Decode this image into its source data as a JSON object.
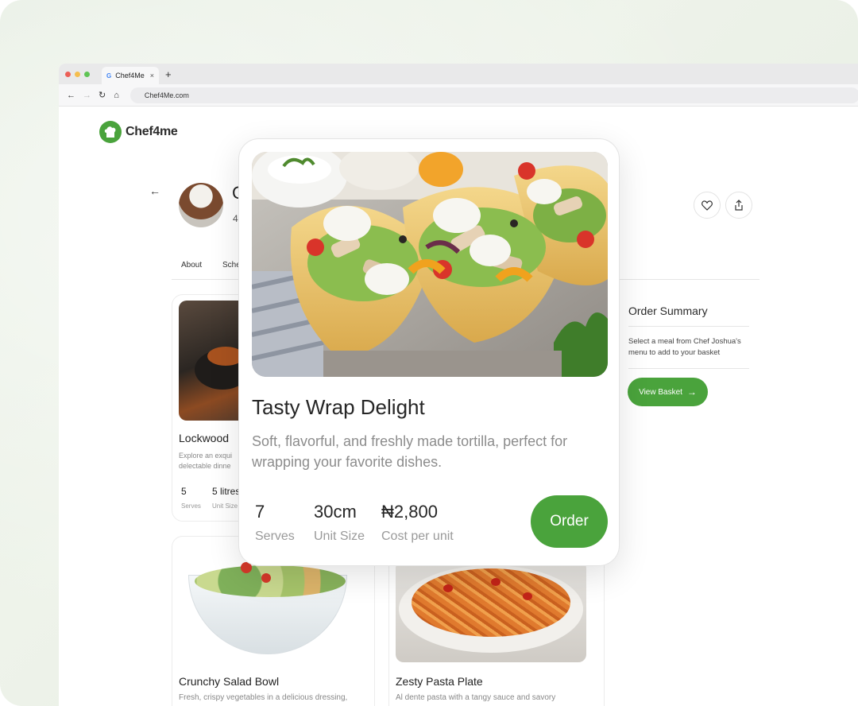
{
  "browser": {
    "tab_title": "Chef4Me",
    "tab_google_glyph": "G",
    "tab_close": "×",
    "new_tab": "+",
    "url": "Chef4Me.com",
    "traffic_lights": [
      "#ec5f57",
      "#f5be4f",
      "#5fc454"
    ]
  },
  "brand": {
    "logo_text": "Chef4me",
    "accent": "#4aa33c"
  },
  "profile": {
    "name_visible": "C",
    "meta_visible": "4"
  },
  "profile_tabs": [
    "About",
    "Sche"
  ],
  "menu_cards": [
    {
      "title": "Lockwood",
      "desc": "Explore an exqui\ndelectable dinne",
      "stats": [
        {
          "value": "5",
          "label": "Serves"
        },
        {
          "value": "5 litres",
          "label": "Unit Size"
        }
      ]
    },
    {
      "title": "Crunchy Salad Bowl",
      "desc": "Fresh, crispy vegetables in a delicious dressing,"
    },
    {
      "title": "Zesty Pasta Plate",
      "desc": "Al dente pasta with a tangy sauce and savory"
    }
  ],
  "order_summary": {
    "title": "Order Summary",
    "text": "Select a meal from Chef Joshua's menu to add to your basket",
    "button_label": "View Basket"
  },
  "modal": {
    "title": "Tasty Wrap Delight",
    "description": "Soft, flavorful, and freshly made tortilla, perfect for wrapping your favorite dishes.",
    "stats": [
      {
        "value": "7",
        "label": "Serves"
      },
      {
        "value": "30cm",
        "label": "Unit Size"
      },
      {
        "value": "₦2,800",
        "label": "Cost per unit"
      }
    ],
    "order_label": "Order"
  }
}
